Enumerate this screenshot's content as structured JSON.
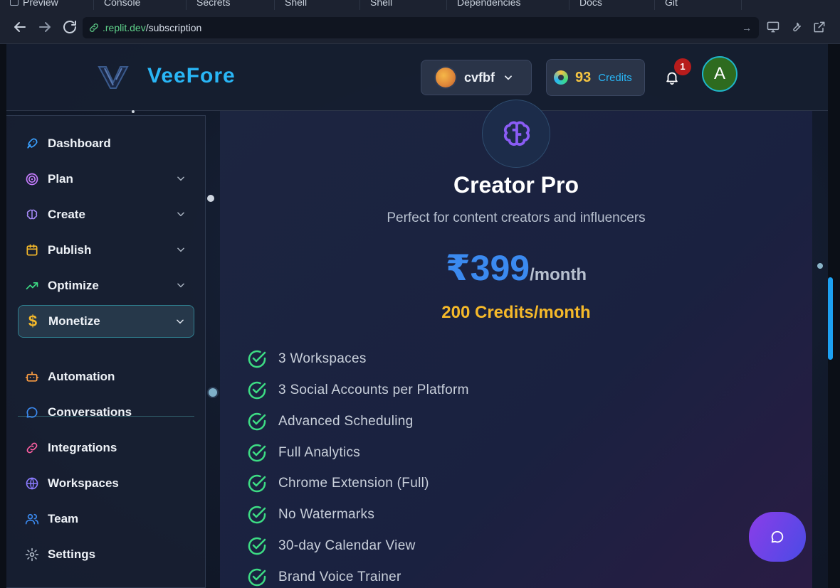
{
  "browser": {
    "tabs": [
      "Preview",
      "Console",
      "Secrets",
      "Shell",
      "Shell",
      "Dependencies",
      "Docs",
      "Git"
    ],
    "url_host": ".replit.dev",
    "url_path": "/subscription"
  },
  "header": {
    "brand": "VeeFore",
    "workspace_name": "cvfbf",
    "credits_count": "93",
    "credits_label": "Credits",
    "notification_count": "1",
    "avatar_initial": "A"
  },
  "sidebar": {
    "items": [
      {
        "label": "Dashboard",
        "icon": "rocket-icon"
      },
      {
        "label": "Plan",
        "icon": "target-icon"
      },
      {
        "label": "Create",
        "icon": "brain-icon"
      },
      {
        "label": "Publish",
        "icon": "calendar-icon"
      },
      {
        "label": "Optimize",
        "icon": "trending-up-icon"
      },
      {
        "label": "Monetize",
        "icon": "dollar-icon"
      },
      {
        "label": "Automation",
        "icon": "bot-icon"
      },
      {
        "label": "Conversations",
        "icon": "chat-bubble-icon"
      },
      {
        "label": "Integrations",
        "icon": "link-icon"
      },
      {
        "label": "Workspaces",
        "icon": "globe-icon"
      },
      {
        "label": "Team",
        "icon": "users-icon"
      },
      {
        "label": "Settings",
        "icon": "gear-icon"
      }
    ],
    "active": "Monetize"
  },
  "plan": {
    "name": "Creator Pro",
    "description": "Perfect for content creators and influencers",
    "price": "₹399",
    "period": "/month",
    "credits": "200 Credits/month",
    "features": [
      "3 Workspaces",
      "3 Social Accounts per Platform",
      "Advanced Scheduling",
      "Full Analytics",
      "Chrome Extension (Full)",
      "No Watermarks",
      "30-day Calendar View",
      "Brand Voice Trainer"
    ]
  },
  "colors": {
    "brand": "#29b6f6",
    "price": "#3b8af0",
    "credits": "#f5b92a",
    "check": "#3ddc84",
    "badge": "#b71c1c"
  }
}
